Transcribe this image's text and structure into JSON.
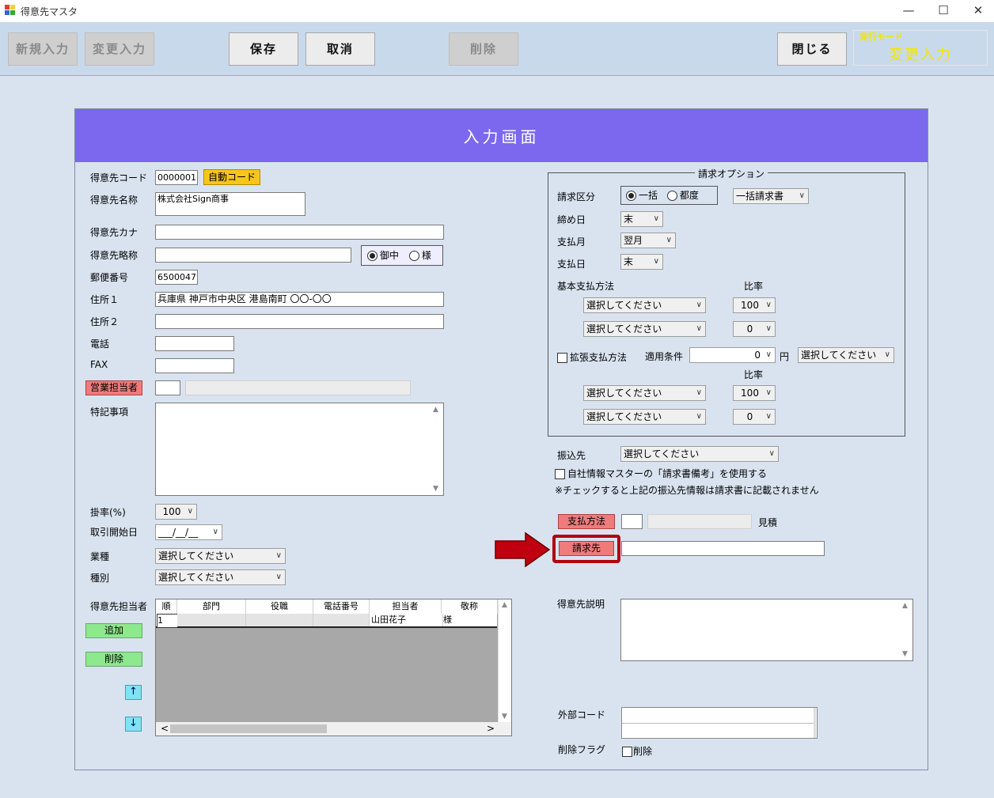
{
  "window": {
    "title": "得意先マスタ",
    "minimize": "—",
    "maximize": "☐",
    "close": "✕"
  },
  "toolbar": {
    "new": "新規入力",
    "change": "変更入力",
    "save": "保存",
    "cancel": "取消",
    "delete": "削除",
    "close": "閉じる",
    "mode_label": "実行モード",
    "mode_value": "変更入力"
  },
  "panel": {
    "title": "入力画面"
  },
  "left": {
    "code_label": "得意先コード",
    "code_value": "0000001",
    "auto_code": "自動コード",
    "name_label": "得意先名称",
    "name_value": "株式会社Sign商事",
    "kana_label": "得意先カナ",
    "short_label": "得意先略称",
    "honorific_1": "御中",
    "honorific_2": "様",
    "zip_label": "郵便番号",
    "zip_value": "6500047",
    "addr1_label": "住所１",
    "addr1_value": "兵庫県 神戸市中央区 港島南町 〇〇-〇〇",
    "addr2_label": "住所２",
    "tel_label": "電話",
    "fax_label": "FAX",
    "sales_button": "営業担当者",
    "notes_label": "特記事項",
    "rate_label": "掛率(%)",
    "rate_value": "100",
    "start_label": "取引開始日",
    "start_value": "___/__/__",
    "industry_label": "業種",
    "industry_value": "選択してください",
    "type_label": "種別",
    "type_value": "選択してください",
    "contacts_label": "得意先担当者",
    "add_button": "追加",
    "remove_button": "削除",
    "up": "↑",
    "down": "↓"
  },
  "grid": {
    "headers": [
      "順",
      "部門",
      "役職",
      "電話番号",
      "担当者",
      "敬称"
    ],
    "row": [
      "1",
      "",
      "",
      "",
      "山田花子",
      "様"
    ],
    "left_arrow": "<",
    "right_arrow": ">"
  },
  "billing": {
    "group_title": "請求オプション",
    "kubun_label": "請求区分",
    "kubun_1": "一括",
    "kubun_2": "都度",
    "kubun_select": "一括請求書",
    "cutoff_label": "締め日",
    "cutoff_value": "末",
    "paymonth_label": "支払月",
    "paymonth_value": "翌月",
    "payday_label": "支払日",
    "payday_value": "末",
    "basic_label": "基本支払方法",
    "ratio_label": "比率",
    "basic_rows": [
      {
        "method": "選択してください",
        "ratio": "100"
      },
      {
        "method": "選択してください",
        "ratio": "0"
      }
    ],
    "ext_label": "拡張支払方法",
    "cond_label": "適用条件",
    "cond_value": "0",
    "yen": "円",
    "cond_select": "選択してください",
    "ratio_label_2": "比率",
    "ext_rows": [
      {
        "method": "選択してください",
        "ratio": "100"
      },
      {
        "method": "選択してください",
        "ratio": "0"
      }
    ]
  },
  "right": {
    "bank_label": "振込先",
    "bank_value": "選択してください",
    "use_remark": "自社情報マスターの「請求書備考」を使用する",
    "note": "※チェックすると上記の振込先情報は請求書に記載されません",
    "paymethod_button": "支払方法",
    "estimate": "見積",
    "billto_button": "請求先",
    "desc_label": "得意先説明",
    "extcode_label": "外部コード",
    "delflag_label": "削除フラグ",
    "delflag_check": "削除"
  },
  "colors": {
    "header": "#7b68ee",
    "red_button": "#ef7b7b",
    "green_button": "#8ee88e",
    "highlight": "#b00010",
    "mode_text": "#f2e600"
  }
}
